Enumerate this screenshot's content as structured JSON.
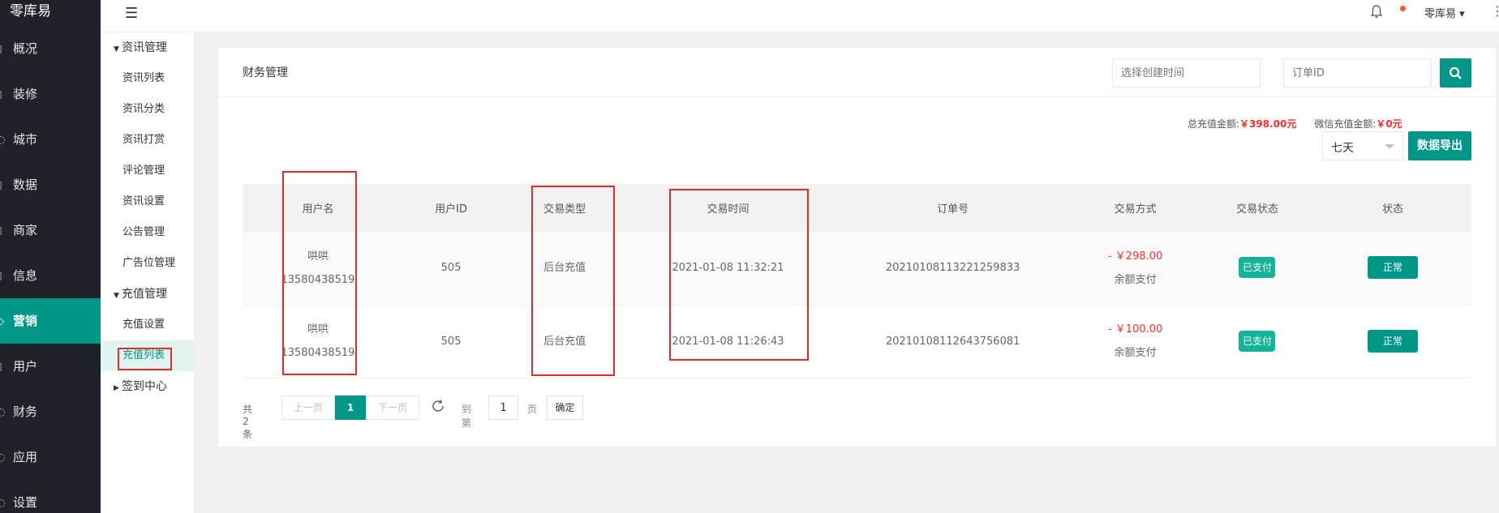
{
  "sidebar": {
    "brand": "零库易",
    "items": [
      {
        "label": "概况",
        "icon": "overview-icon"
      },
      {
        "label": "装修",
        "icon": "decor-icon"
      },
      {
        "label": "城市",
        "icon": "city-icon"
      },
      {
        "label": "数据",
        "icon": "data-icon"
      },
      {
        "label": "商家",
        "icon": "merchant-icon"
      },
      {
        "label": "信息",
        "icon": "info-icon"
      },
      {
        "label": "营销",
        "icon": "marketing-icon",
        "active": true
      },
      {
        "label": "用户",
        "icon": "user-icon"
      },
      {
        "label": "财务",
        "icon": "finance-icon"
      },
      {
        "label": "应用",
        "icon": "app-icon"
      },
      {
        "label": "设置",
        "icon": "settings-icon"
      }
    ]
  },
  "subnav": {
    "group1": "资讯管理",
    "group1_items": [
      "资讯列表",
      "资讯分类",
      "资讯打赏",
      "评论管理",
      "资讯设置",
      "公告管理",
      "广告位管理"
    ],
    "group2": "充值管理",
    "group2_items": [
      "充值设置",
      "充值列表"
    ],
    "group3": "签到中心"
  },
  "topbar": {
    "user": "零库易"
  },
  "card": {
    "title": "财务管理",
    "date_placeholder": "选择创建时间",
    "order_placeholder": "订单ID",
    "total_label": "总充值金额:",
    "total_value": "￥398.00元",
    "wechat_label": "微信充值金额:",
    "wechat_value": "￥0元",
    "range": "七天",
    "export": "数据导出"
  },
  "table": {
    "headers": [
      "用户名",
      "用户ID",
      "交易类型",
      "交易时间",
      "订单号",
      "交易方式",
      "交易状态",
      "状态"
    ],
    "rows": [
      {
        "name": "哄哄",
        "phone": "13580438519",
        "uid": "505",
        "type": "后台充值",
        "time": "2021-01-08 11:32:21",
        "order": "20210108113221259833",
        "price": "- ￥298.00",
        "method": "余额支付",
        "pay_status": "已支付",
        "status": "正常"
      },
      {
        "name": "哄哄",
        "phone": "13580438519",
        "uid": "505",
        "type": "后台充值",
        "time": "2021-01-08 11:26:43",
        "order": "20210108112643756081",
        "price": "- ￥100.00",
        "method": "余额支付",
        "pay_status": "已支付",
        "status": "正常"
      }
    ]
  },
  "pager": {
    "count": "共 2 条",
    "prev": "上一页",
    "current": "1",
    "next": "下一页",
    "goto": "到第",
    "page_value": "1",
    "page_unit": "页",
    "confirm": "确定"
  },
  "colors": {
    "primary": "#009688",
    "sidebar_bg": "#20222a",
    "highlight": "#e52b2b",
    "price": "#ff2a2a"
  }
}
